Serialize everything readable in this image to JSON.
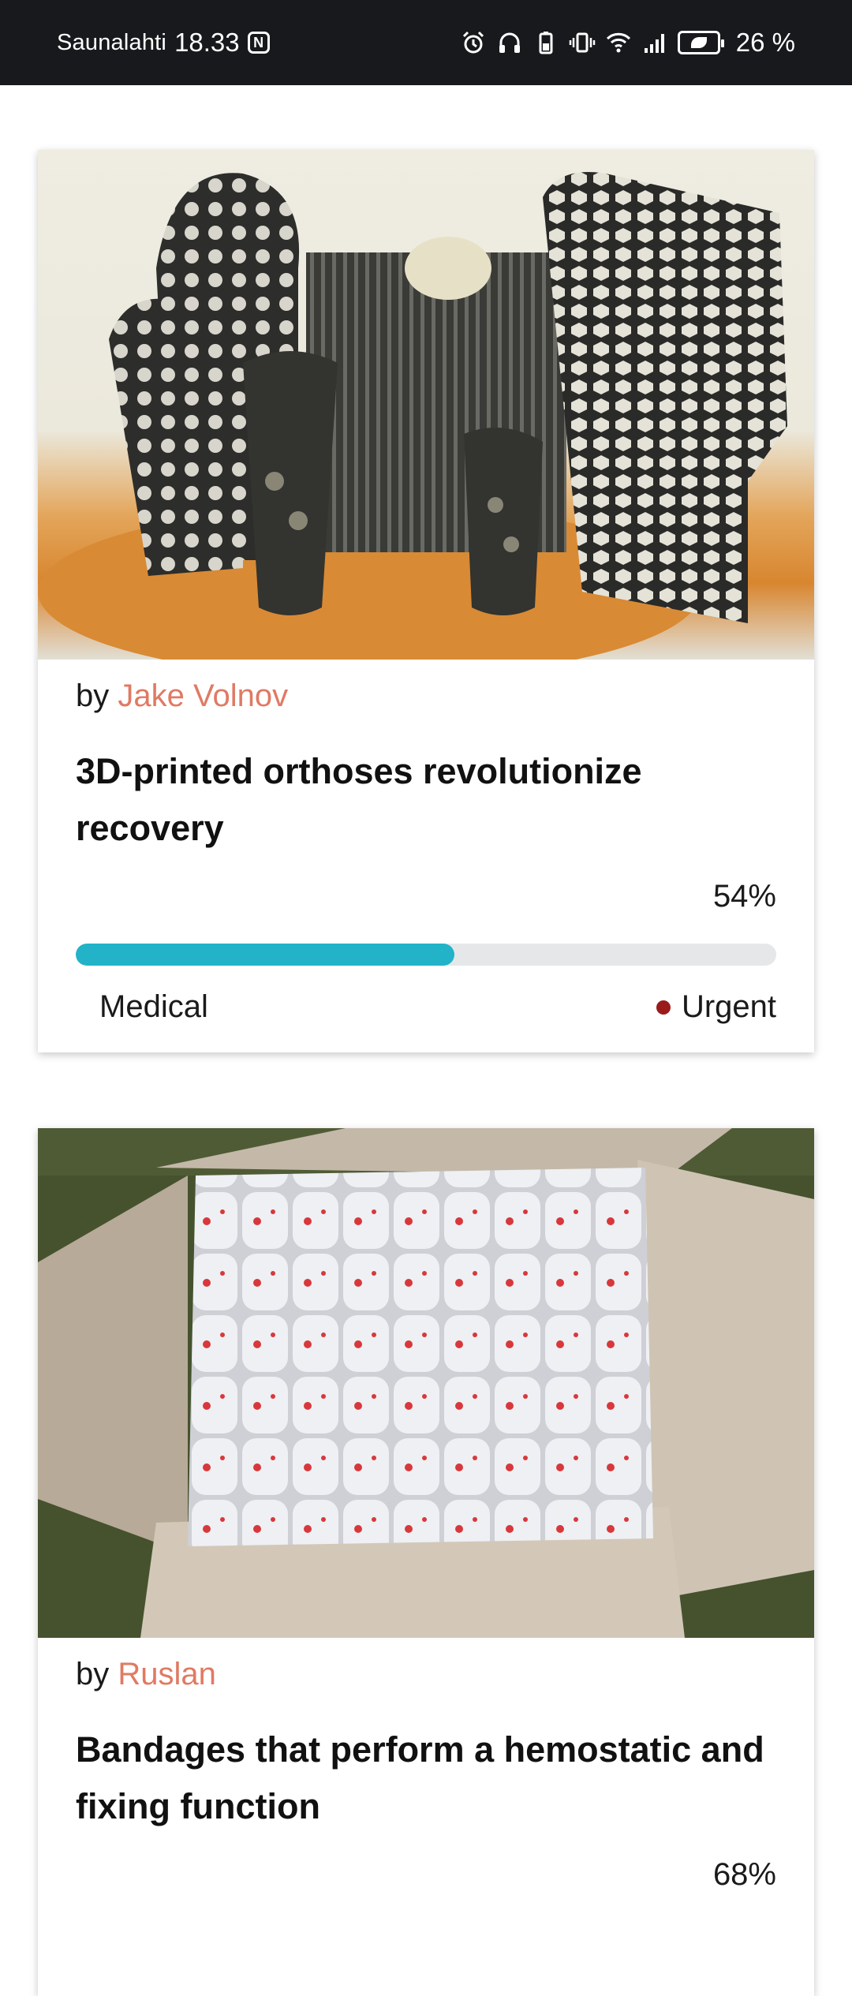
{
  "status_bar": {
    "carrier": "Saunalahti",
    "time": "18.33",
    "nfc": "N",
    "battery_percent": "26 %",
    "icons": [
      "alarm-icon",
      "headphones-icon",
      "battery-saver-icon",
      "vibrate-icon",
      "wifi-icon",
      "signal-icon",
      "battery-icon"
    ]
  },
  "colors": {
    "author": "#e07a63",
    "progress_fill": "#22b3c8",
    "progress_track": "#e6e7e9",
    "urgent_dot": "#9b1b1b"
  },
  "cards": [
    {
      "by_prefix": "by",
      "author": "Jake Volnov",
      "title": "3D-printed orthoses revolutionize recovery",
      "percent_label": "54%",
      "progress": 54,
      "category": "Medical",
      "urgency": "Urgent"
    },
    {
      "by_prefix": "by",
      "author": "Ruslan",
      "title": "Bandages that perform a hemostatic and fixing function",
      "percent_label": "68%",
      "progress": 68
    }
  ]
}
